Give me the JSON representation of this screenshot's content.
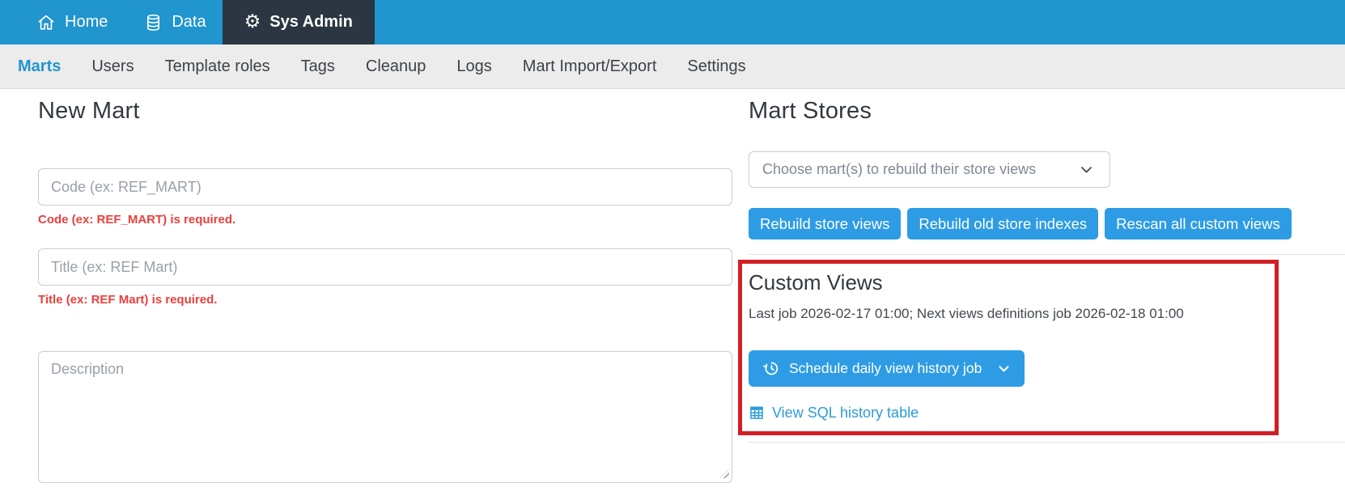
{
  "topnav": {
    "items": [
      {
        "label": "Home",
        "icon": "home-icon",
        "active": false
      },
      {
        "label": "Data",
        "icon": "database-icon",
        "active": false
      },
      {
        "label": "Sys Admin",
        "icon": "gear-icon",
        "active": true
      }
    ]
  },
  "subnav": {
    "items": [
      {
        "label": "Marts",
        "active": true
      },
      {
        "label": "Users",
        "active": false
      },
      {
        "label": "Template roles",
        "active": false
      },
      {
        "label": "Tags",
        "active": false
      },
      {
        "label": "Cleanup",
        "active": false
      },
      {
        "label": "Logs",
        "active": false
      },
      {
        "label": "Mart Import/Export",
        "active": false
      },
      {
        "label": "Settings",
        "active": false
      }
    ]
  },
  "new_mart": {
    "title": "New Mart",
    "code_placeholder": "Code (ex: REF_MART)",
    "code_error": "Code (ex: REF_MART) is required.",
    "title_placeholder": "Title (ex: REF Mart)",
    "title_error": "Title (ex: REF Mart) is required.",
    "description_placeholder": "Description"
  },
  "mart_stores": {
    "title": "Mart Stores",
    "select_placeholder": "Choose mart(s) to rebuild their store views",
    "buttons": [
      "Rebuild store views",
      "Rebuild old store indexes",
      "Rescan all custom views"
    ]
  },
  "custom_views": {
    "title": "Custom Views",
    "status": "Last job 2026-02-17 01:00; Next views definitions job 2026-02-18 01:00",
    "schedule_button": "Schedule daily view history job",
    "link": "View SQL history table"
  },
  "colors": {
    "nav_blue": "#2095ce",
    "active_tab_dark": "#2b3642",
    "button_blue": "#2e9ce4",
    "link_blue": "#2b9cd8",
    "error_red": "#e8413c",
    "highlight_border_red": "#d21f26",
    "subnav_bg": "#ececec"
  }
}
